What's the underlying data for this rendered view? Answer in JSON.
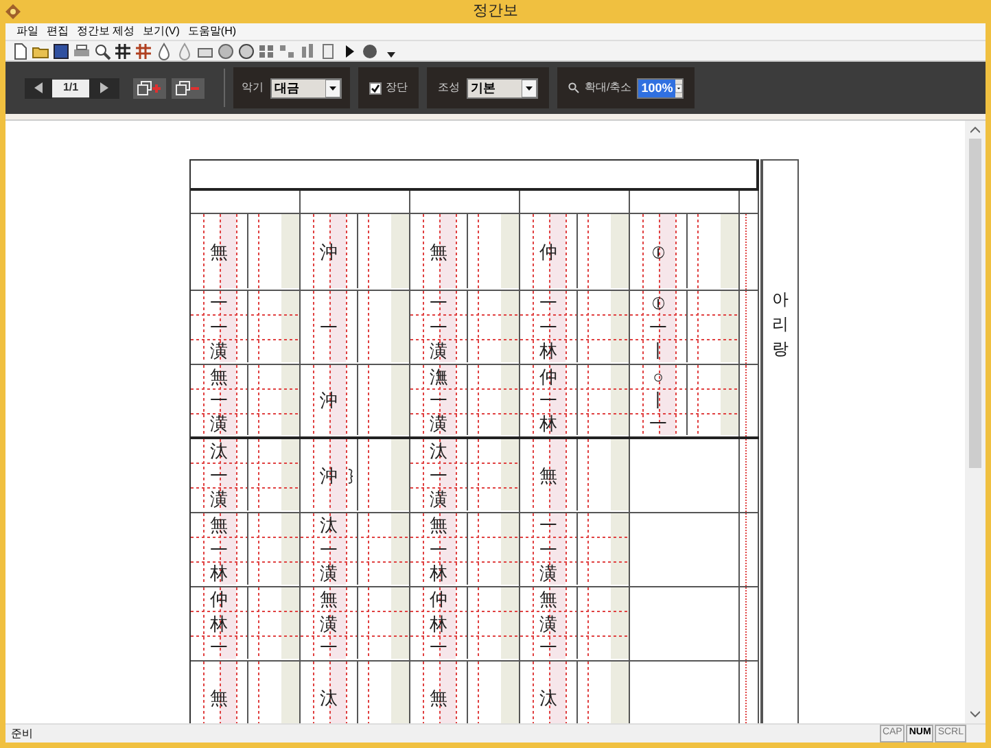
{
  "window": {
    "title": "정간보"
  },
  "menu": [
    "파일",
    "편집",
    "정간보 제성",
    "보기(V)",
    "도움말(H)"
  ],
  "pager": {
    "page": "1/1"
  },
  "instrument": {
    "label": "악기",
    "value": "대금"
  },
  "jangdan": {
    "label": "장단",
    "checked": true
  },
  "mode": {
    "label": "조성",
    "value": "기본"
  },
  "zoom": {
    "label": "확대/축소",
    "value": "100%"
  },
  "score": {
    "side_title": "아리랑",
    "columns": [
      {
        "cells": [
          {
            "kind": "notes",
            "notes": [
              "無"
            ]
          },
          {
            "kind": "notes",
            "notes": [
              "一",
              "一",
              "潢"
            ]
          },
          {
            "kind": "notes",
            "notes": [
              "無",
              "一",
              "潢"
            ]
          },
          {
            "kind": "notes",
            "notes": [
              "汰",
              "一",
              "潢"
            ]
          },
          {
            "kind": "notes",
            "notes": [
              "無",
              "一",
              "林"
            ]
          },
          {
            "kind": "notes",
            "notes": [
              "仲",
              "林",
              "一"
            ]
          },
          {
            "kind": "notes",
            "notes": [
              "無"
            ]
          }
        ]
      },
      {
        "cells": [
          {
            "kind": "notes",
            "notes": [
              "沖"
            ]
          },
          {
            "kind": "notes",
            "notes": [
              "一"
            ]
          },
          {
            "kind": "notes",
            "notes": [
              "沖"
            ]
          },
          {
            "kind": "notes",
            "notes": [
              "沖"
            ],
            "ornament": true
          },
          {
            "kind": "notes",
            "notes": [
              "汰",
              "一",
              "潢"
            ]
          },
          {
            "kind": "notes",
            "notes": [
              "無",
              "潢",
              "一"
            ]
          },
          {
            "kind": "notes",
            "notes": [
              "汰"
            ]
          }
        ]
      },
      {
        "cells": [
          {
            "kind": "notes",
            "notes": [
              "無"
            ]
          },
          {
            "kind": "notes",
            "notes": [
              "一",
              "一",
              "潢"
            ]
          },
          {
            "kind": "notes",
            "notes": [
              "潕",
              "一",
              "潢"
            ]
          },
          {
            "kind": "notes",
            "notes": [
              "汰",
              "一",
              "潢"
            ]
          },
          {
            "kind": "notes",
            "notes": [
              "無",
              "一",
              "林"
            ]
          },
          {
            "kind": "notes",
            "notes": [
              "仲",
              "林",
              "一"
            ]
          },
          {
            "kind": "notes",
            "notes": [
              "無"
            ]
          }
        ]
      },
      {
        "cells": [
          {
            "kind": "notes",
            "notes": [
              "仲"
            ]
          },
          {
            "kind": "notes",
            "notes": [
              "一",
              "一",
              "林"
            ]
          },
          {
            "kind": "notes",
            "notes": [
              "仲",
              "一",
              "林"
            ]
          },
          {
            "kind": "notes",
            "notes": [
              "無"
            ]
          },
          {
            "kind": "notes",
            "notes": [
              "一",
              "一",
              "潢"
            ]
          },
          {
            "kind": "notes",
            "notes": [
              "無",
              "潢",
              "一"
            ]
          },
          {
            "kind": "notes",
            "notes": [
              "汰"
            ]
          }
        ]
      },
      {
        "cells": [
          {
            "kind": "notes",
            "notes": [
              "⦶"
            ]
          },
          {
            "kind": "notes",
            "notes": [
              "⦶",
              "一",
              "丨"
            ]
          },
          {
            "kind": "notes",
            "notes": [
              "○",
              "丨",
              "一"
            ]
          },
          {
            "kind": "empty"
          },
          {
            "kind": "empty"
          },
          {
            "kind": "empty"
          },
          {
            "kind": "empty"
          }
        ]
      }
    ]
  },
  "status_bar": {
    "text": "준비",
    "indicators": [
      {
        "label": "CAP",
        "on": false
      },
      {
        "label": "NUM",
        "on": true
      },
      {
        "label": "SCRL",
        "on": false
      }
    ]
  }
}
